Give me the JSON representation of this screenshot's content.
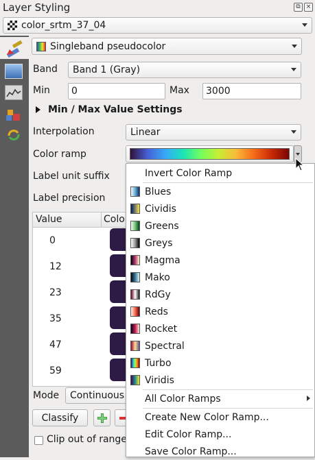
{
  "panel": {
    "title": "Layer Styling",
    "layer_name": "color_srtm_37_04"
  },
  "renderer": {
    "type": "Singleband pseudocolor",
    "band_label": "Band",
    "band_value": "Band 1 (Gray)",
    "min_label": "Min",
    "min_value": "0",
    "max_label": "Max",
    "max_value": "3000",
    "minmax_settings": "Min / Max Value Settings",
    "interpolation_label": "Interpolation",
    "interpolation_value": "Linear",
    "color_ramp_label": "Color ramp",
    "label_unit_suffix": "Label unit suffix",
    "label_precision": "Label precision"
  },
  "table": {
    "col_value": "Value",
    "col_color": "Color",
    "rows": [
      {
        "value": "0"
      },
      {
        "value": "12"
      },
      {
        "value": "23"
      },
      {
        "value": "35"
      },
      {
        "value": "47"
      },
      {
        "value": "59"
      }
    ]
  },
  "bottom": {
    "mode_label": "Mode",
    "mode_value": "Continuous",
    "classify_button": "Classify",
    "clip_label": "Clip out of range"
  },
  "menu": {
    "invert": "Invert Color Ramp",
    "ramps": [
      {
        "name": "Blues",
        "gradient": "linear-gradient(to right,#f7fbff,#6baed6,#08306b)"
      },
      {
        "name": "Cividis",
        "gradient": "linear-gradient(to right,#00224e,#7d7c78,#fee838)"
      },
      {
        "name": "Greens",
        "gradient": "linear-gradient(to right,#f7fcf5,#74c476,#00441b)"
      },
      {
        "name": "Greys",
        "gradient": "linear-gradient(to right,#ffffff,#969696,#000000)"
      },
      {
        "name": "Magma",
        "gradient": "linear-gradient(to right,#000004,#b73779,#fcfdbf)"
      },
      {
        "name": "Mako",
        "gradient": "linear-gradient(to right,#0b0405,#357ba2,#def5e5)"
      },
      {
        "name": "RdGy",
        "gradient": "linear-gradient(to right,#67001f,#ffffff,#1a1a1a)"
      },
      {
        "name": "Reds",
        "gradient": "linear-gradient(to right,#fff5f0,#fb6a4a,#67000d)"
      },
      {
        "name": "Rocket",
        "gradient": "linear-gradient(to right,#03051a,#cb1b4f,#faebdd)"
      },
      {
        "name": "Spectral",
        "gradient": "linear-gradient(to right,#9e0142,#fee08b,#5e4fa2)"
      },
      {
        "name": "Turbo",
        "gradient": "linear-gradient(to right,#30123b,#28bceb,#a4fc3c,#fb8022,#7a0403)"
      },
      {
        "name": "Viridis",
        "gradient": "linear-gradient(to right,#440154,#21918c,#fde725)"
      }
    ],
    "all_ramps": "All Color Ramps",
    "create_new": "Create New Color Ramp...",
    "edit": "Edit Color Ramp...",
    "save": "Save Color Ramp..."
  }
}
